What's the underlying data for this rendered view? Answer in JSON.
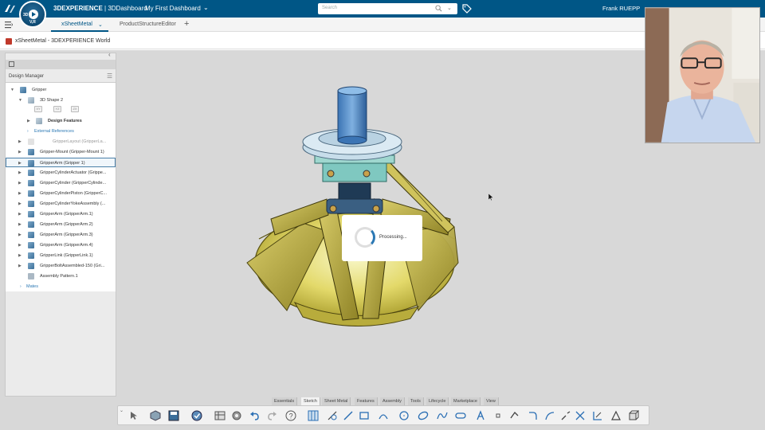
{
  "topbar": {
    "brand_bold": "3DEXPERIENCE",
    "brand_rest": " | 3DDashboard",
    "dashboard_title": "My First Dashboard",
    "search_placeholder": "Search",
    "user_name": "Frank RUEPP",
    "compass_labels": [
      "3D",
      "V,R"
    ],
    "bg_color": "#005686"
  },
  "tabs": [
    {
      "label": "xSheetMetal",
      "active": true
    },
    {
      "label": "ProductStructureEditor",
      "active": false
    }
  ],
  "app": {
    "title": "xSheetMetal - 3DEXPERIENCE World"
  },
  "tree": {
    "panel_title": "Design Manager",
    "rows": [
      {
        "label": "Gripper",
        "icon": "assembly-icon"
      },
      {
        "label": "3D Shape 2",
        "icon": "shape-icon"
      },
      {
        "label": "Design Features",
        "icon": "features-icon"
      },
      {
        "label": "External References",
        "icon": "none"
      },
      {
        "label": "GripperLayout (GripperLa...",
        "icon": "sketch-icon"
      },
      {
        "label": "Gripper-Mount (Gripper-Mount 1)",
        "icon": "part-icon"
      },
      {
        "label": "GripperArm (Gripper 1)",
        "icon": "part-icon",
        "selected": true
      },
      {
        "label": "GripperCylinderActuator (Grippe...",
        "icon": "part-icon"
      },
      {
        "label": "GripperCylinder (GripperCylinde...",
        "icon": "part-icon"
      },
      {
        "label": "GripperCylinderPiston (GripperC...",
        "icon": "part-icon"
      },
      {
        "label": "GripperCylinderYokeAssembly (...",
        "icon": "part-icon"
      },
      {
        "label": "GripperArm (GripperArm.1)",
        "icon": "part-icon"
      },
      {
        "label": "GripperArm (GripperArm.2)",
        "icon": "part-icon"
      },
      {
        "label": "GripperArm (GripperArm.3)",
        "icon": "part-icon"
      },
      {
        "label": "GripperArm (GripperArm.4)",
        "icon": "part-icon"
      },
      {
        "label": "GripperLink (GripperLink.1)",
        "icon": "part-icon"
      },
      {
        "label": "GripperBoltAssembled-150 (Gri...",
        "icon": "part-icon"
      },
      {
        "label": "Assembly Pattern.1",
        "icon": "pattern-icon"
      },
      {
        "label": "Mates",
        "icon": "none"
      }
    ],
    "feature_icons": [
      "XY",
      "YZ",
      "ZX"
    ]
  },
  "dialog": {
    "text": "Processing..."
  },
  "toolbar": {
    "tabs": [
      "Essentials",
      "Sketch",
      "Sheet Metal",
      "Features",
      "Assembly",
      "Tools",
      "Lifecycle",
      "Marketplace",
      "View"
    ],
    "active_tab": "Sketch",
    "tools": [
      "select-icon",
      "part-icon",
      "save-icon",
      "check-icon",
      "table-icon",
      "settings-icon",
      "undo-icon",
      "redo-icon",
      "help-icon",
      "grid-icon",
      "smart-dimension-icon",
      "line-icon",
      "rectangle-icon",
      "arc-icon",
      "circle-icon",
      "ellipse-icon",
      "spline-icon",
      "slot-icon",
      "text-icon",
      "point-icon",
      "offset-icon",
      "fillet-icon",
      "trim-icon",
      "extend-icon",
      "convert-icon",
      "mirror-icon",
      "pattern-icon",
      "cube-icon"
    ]
  }
}
